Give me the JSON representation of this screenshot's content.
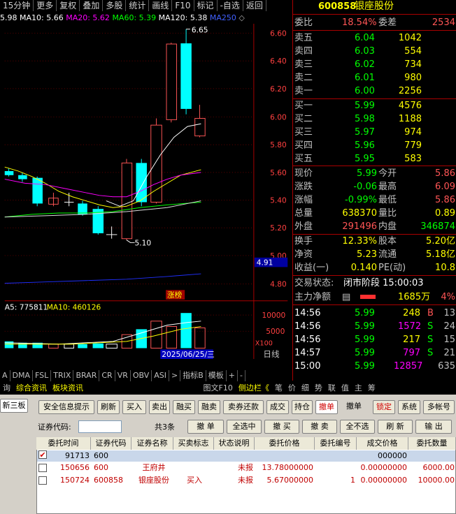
{
  "toolbar": {
    "timeframe": "15分钟",
    "more": "更多",
    "items": [
      "复权",
      "叠加",
      "多股",
      "统计",
      "画线",
      "F10",
      "标记",
      "-自选",
      "返回"
    ]
  },
  "ma_bar": {
    "ma5": "5.98",
    "ma10": "MA10: 5.66",
    "ma20": "MA20: 5.62",
    "ma60": "MA60: 5.39",
    "ma120": "MA120: 5.38",
    "ma250": "MA250"
  },
  "price_axis": [
    "6.60",
    "6.40",
    "6.20",
    "6.00",
    "5.80",
    "5.60",
    "5.40",
    "5.20",
    "5.00",
    "4.80"
  ],
  "price_tag": "4.91",
  "annotations": {
    "high": "6.65",
    "low": "5.10",
    "limit_up_tag": "涨榜"
  },
  "volume_bar": {
    "ma5": "A5: 775811",
    "ma10": "MA10: 460126"
  },
  "volume_axis": [
    "10000",
    "5000"
  ],
  "volume_unit": "X100",
  "date_label": "2025/06/25/三",
  "period_label": "日线",
  "indicator_tabs": [
    "A",
    "DMA",
    "FSL",
    "TRIX",
    "BRAR",
    "CR",
    "VR",
    "OBV",
    "ASI",
    ">",
    "指标B",
    "模板",
    "+",
    "-"
  ],
  "lower_tabs": [
    "询",
    "综合资讯",
    "板块资讯"
  ],
  "lower_right_tabs": [
    "图文F10",
    "侧边栏《",
    "笔",
    "价",
    "细",
    "势",
    "联",
    "值",
    "主",
    "筹"
  ],
  "quote": {
    "code": "600858",
    "name": "银座股份",
    "weibi_label": "委比",
    "weibi": "18.54%",
    "weicha_label": "委差",
    "weicha": "2534",
    "asks": [
      {
        "label": "卖五",
        "price": "6.04",
        "vol": "1042"
      },
      {
        "label": "卖四",
        "price": "6.03",
        "vol": "554"
      },
      {
        "label": "卖三",
        "price": "6.02",
        "vol": "734"
      },
      {
        "label": "卖二",
        "price": "6.01",
        "vol": "980"
      },
      {
        "label": "卖一",
        "price": "6.00",
        "vol": "2256"
      }
    ],
    "bids": [
      {
        "label": "买一",
        "price": "5.99",
        "vol": "4576"
      },
      {
        "label": "买二",
        "price": "5.98",
        "vol": "1188"
      },
      {
        "label": "买三",
        "price": "5.97",
        "vol": "974"
      },
      {
        "label": "买四",
        "price": "5.96",
        "vol": "779"
      },
      {
        "label": "买五",
        "price": "5.95",
        "vol": "583"
      }
    ],
    "stats": [
      {
        "l1": "现价",
        "v1": "5.99",
        "l2": "今开",
        "v2": "5.86"
      },
      {
        "l1": "涨跌",
        "v1": "-0.06",
        "l2": "最高",
        "v2": "6.09"
      },
      {
        "l1": "涨幅",
        "v1": "-0.99%",
        "l2": "最低",
        "v2": "5.86"
      },
      {
        "l1": "总量",
        "v1": "638370",
        "l2": "量比",
        "v2": "0.89"
      },
      {
        "l1": "外盘",
        "v1": "291496",
        "l2": "内盘",
        "v2": "346874"
      }
    ],
    "stats2": [
      {
        "l1": "换手",
        "v1": "12.33%",
        "l2": "股本",
        "v2": "5.20亿"
      },
      {
        "l1": "净资",
        "v1": "5.23",
        "l2": "流通",
        "v2": "5.18亿"
      },
      {
        "l1": "收益(一)",
        "v1": "0.140",
        "l2": "PE(动)",
        "v2": "10.8"
      }
    ],
    "trade_status_label": "交易状态:",
    "trade_status": "闭市阶段 15:00:03",
    "net_label": "主力净额",
    "net_value": "1685万",
    "net_pct": "4%",
    "ticks": [
      {
        "time": "14:56",
        "price": "5.99",
        "vol": "248",
        "bs": "B",
        "n": "13"
      },
      {
        "time": "14:56",
        "price": "5.99",
        "vol": "1572",
        "bs": "S",
        "n": "24"
      },
      {
        "time": "14:56",
        "price": "5.99",
        "vol": "217",
        "bs": "S",
        "n": "15"
      },
      {
        "time": "14:57",
        "price": "5.99",
        "vol": "797",
        "bs": "S",
        "n": "21"
      },
      {
        "time": "15:00",
        "price": "5.99",
        "vol": "12857",
        "bs": "",
        "n": "635"
      }
    ]
  },
  "trade": {
    "side_tab": "新三板",
    "buttons": [
      "安全信息提示",
      "刷新",
      "买入",
      "卖出",
      "融买",
      "融卖",
      "卖券还款",
      "成交",
      "持仓",
      "撤单",
      "撤单",
      "锁定",
      "系统",
      "多帐号"
    ],
    "code_label": "证券代码:",
    "count": "共3条",
    "actions": [
      "撤 单",
      "全选中",
      "撤 买",
      "撤 卖",
      "全不选",
      "刷 新",
      "输 出"
    ],
    "headers": [
      "委托时间",
      "证券代码",
      "证券名称",
      "买卖标志",
      "状态说明",
      "委托价格",
      "委托编号",
      "成交价格",
      "委托数量"
    ],
    "rows": [
      {
        "time": "91713",
        "code": "600",
        "name": "",
        "flag": "",
        "status": "",
        "price": "",
        "no": "",
        "dprice": "000000",
        "qty": ""
      },
      {
        "time": "150656",
        "code": "600",
        "name": "王府井",
        "flag": "",
        "status": "未报",
        "price": "13.78000000",
        "no": "",
        "dprice": "0.00000000",
        "qty": "6000.00"
      },
      {
        "time": "150724",
        "code": "600858",
        "name": "银座股份",
        "flag": "买入",
        "status": "未报",
        "price": "5.67000000",
        "no": "1",
        "dprice": "0.00000000",
        "qty": "10000.00"
      }
    ]
  }
}
